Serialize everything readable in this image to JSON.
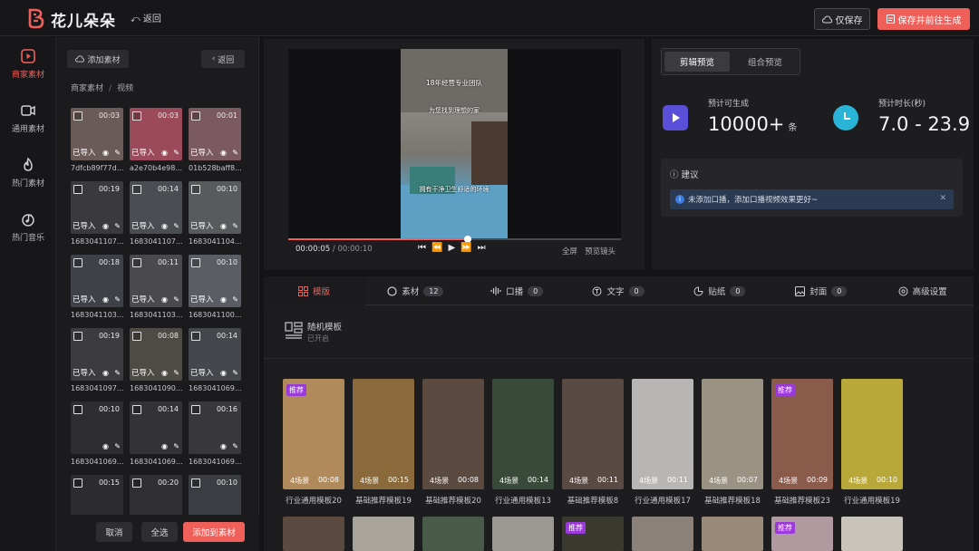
{
  "topbar": {
    "brand": "花儿朵朵",
    "back": "返回",
    "save_only": "仅保存",
    "save_and_generate": "保存并前往生成"
  },
  "leftnav": {
    "items": [
      {
        "label": "商家素材",
        "icon": "film-icon",
        "active": true
      },
      {
        "label": "通用素材",
        "icon": "video-camera-icon",
        "active": false
      },
      {
        "label": "热门素材",
        "icon": "fire-icon",
        "active": false
      },
      {
        "label": "热门音乐",
        "icon": "music-icon",
        "active": false
      }
    ]
  },
  "material": {
    "add_button": "添加素材",
    "back_button": "返回",
    "breadcrumb": [
      "商家素材",
      "视频"
    ],
    "imported_label": "已导入",
    "items": [
      {
        "name": "7dfcb89f77d...",
        "duration": "00:03",
        "imported": true,
        "color": "#6a5a58"
      },
      {
        "name": "a2e70b4e98...",
        "duration": "00:03",
        "imported": true,
        "color": "#9a4a5a"
      },
      {
        "name": "01b528baff8...",
        "duration": "00:01",
        "imported": true,
        "color": "#7a5a60"
      },
      {
        "name": "1683041107...",
        "duration": "00:19",
        "imported": true,
        "color": "#3a3a3e"
      },
      {
        "name": "1683041107...",
        "duration": "00:14",
        "imported": true,
        "color": "#4a4e52"
      },
      {
        "name": "1683041104...",
        "duration": "00:10",
        "imported": true,
        "color": "#585a5c"
      },
      {
        "name": "1683041103...",
        "duration": "00:18",
        "imported": true,
        "color": "#3e4248"
      },
      {
        "name": "1683041103...",
        "duration": "00:11",
        "imported": true,
        "color": "#4a4a4e"
      },
      {
        "name": "1683041100...",
        "duration": "00:10",
        "imported": true,
        "color": "#5a5e64"
      },
      {
        "name": "1683041097...",
        "duration": "00:19",
        "imported": true,
        "color": "#3c3c40"
      },
      {
        "name": "1683041090...",
        "duration": "00:08",
        "imported": true,
        "color": "#4e4a44"
      },
      {
        "name": "1683041069...",
        "duration": "00:14",
        "imported": true,
        "color": "#44484c"
      },
      {
        "name": "1683041069...",
        "duration": "00:10",
        "imported": false,
        "color": "#2e2e32"
      },
      {
        "name": "1683041069...",
        "duration": "00:14",
        "imported": false,
        "color": "#333337"
      },
      {
        "name": "1683041069...",
        "duration": "00:16",
        "imported": false,
        "color": "#38383c"
      },
      {
        "name": "",
        "duration": "00:15",
        "imported": false,
        "color": "#2c2c30"
      },
      {
        "name": "",
        "duration": "00:20",
        "imported": false,
        "color": "#303034"
      },
      {
        "name": "",
        "duration": "00:10",
        "imported": false,
        "color": "#3a3e42"
      }
    ],
    "cancel": "取消",
    "select_all": "全选",
    "add_to_material": "添加到素材"
  },
  "preview": {
    "video_texts": [
      "18年经营专业团队",
      "为您找到理想的家",
      "拥有干净卫生舒适的环境"
    ],
    "current_time": "00:00:05",
    "total_time": "00:00:10",
    "progress_fraction": 0.54,
    "fullscreen": "全屏",
    "preview_lens": "预览镜头"
  },
  "stats": {
    "tab_edit": "剪辑预览",
    "tab_combo": "组合预览",
    "est_label": "预计可生成",
    "est_value": "10000+",
    "est_unit": "条",
    "dur_label": "预计时长(秒)",
    "dur_value": "7.0 - 23.9",
    "advice_title": "建议",
    "advice_msg": "未添加口播，添加口播视频效果更好~"
  },
  "tabs": [
    {
      "label": "模版",
      "icon": "grid-icon",
      "count": null,
      "active": true
    },
    {
      "label": "素材",
      "icon": "circle-icon",
      "count": "12",
      "active": false
    },
    {
      "label": "口播",
      "icon": "waveform-icon",
      "count": "0",
      "active": false
    },
    {
      "label": "文字",
      "icon": "text-icon",
      "count": "0",
      "active": false
    },
    {
      "label": "贴纸",
      "icon": "sticker-icon",
      "count": "0",
      "active": false
    },
    {
      "label": "封面",
      "icon": "image-icon",
      "count": "0",
      "active": false
    },
    {
      "label": "高级设置",
      "icon": "settings-icon",
      "count": null,
      "active": false
    }
  ],
  "template_option": {
    "name": "随机模板",
    "status": "已开启"
  },
  "templates": {
    "recommended_label": "推荐",
    "items": [
      {
        "name": "行业通用模板20",
        "scenes": "4场景",
        "duration": "00:08",
        "recommended": true,
        "color": "#b08a5a"
      },
      {
        "name": "基础推荐模板19",
        "scenes": "4场景",
        "duration": "00:15",
        "recommended": false,
        "color": "#8a6a3a"
      },
      {
        "name": "基础推荐模板20",
        "scenes": "4场景",
        "duration": "00:08",
        "recommended": false,
        "color": "#5a4a40"
      },
      {
        "name": "行业通用模板13",
        "scenes": "4场景",
        "duration": "00:14",
        "recommended": false,
        "color": "#3a4a3a"
      },
      {
        "name": "基础推荐模板8",
        "scenes": "4场景",
        "duration": "00:11",
        "recommended": false,
        "color": "#5a4a44"
      },
      {
        "name": "行业通用模板17",
        "scenes": "4场景",
        "duration": "00:11",
        "recommended": false,
        "color": "#b8b6b4"
      },
      {
        "name": "基础推荐模板18",
        "scenes": "4场景",
        "duration": "00:07",
        "recommended": false,
        "color": "#9a9282"
      },
      {
        "name": "基础推荐模板23",
        "scenes": "4场景",
        "duration": "00:09",
        "recommended": true,
        "color": "#8a5a4a"
      },
      {
        "name": "行业通用模板19",
        "scenes": "4场景",
        "duration": "00:10",
        "recommended": false,
        "color": "#b8a83a"
      }
    ],
    "row2_colors": [
      "#5a4a40",
      "#a8a49c",
      "#4a5a4a",
      "#9a9890",
      "#3a3a30",
      "#8a8278",
      "#9a8a7a",
      "#b09aa0",
      "#c8c4bc"
    ],
    "row2_recommended": [
      false,
      false,
      false,
      false,
      true,
      false,
      false,
      true,
      false
    ]
  }
}
